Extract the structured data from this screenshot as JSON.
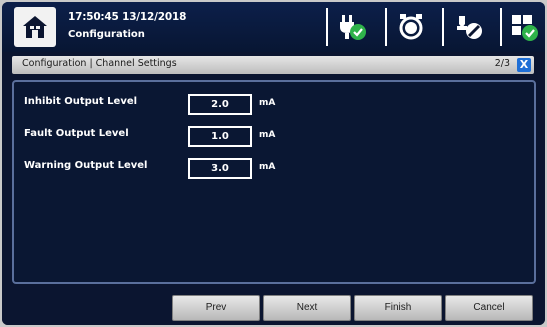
{
  "header": {
    "datetime": "17:50:45 13/12/2018",
    "subtitle": "Configuration",
    "icons": [
      "home-icon",
      "power-plug-ok-icon",
      "alarm-clock-icon",
      "calibration-off-icon",
      "grid-ok-icon"
    ]
  },
  "titlebar": {
    "title": "Configuration | Channel Settings",
    "page": "2/3",
    "close_label": "X"
  },
  "settings": [
    {
      "label": "Inhibit Output Level",
      "value": "2.0",
      "unit": "mA"
    },
    {
      "label": "Fault Output Level",
      "value": "1.0",
      "unit": "mA"
    },
    {
      "label": "Warning Output Level",
      "value": "3.0",
      "unit": "mA"
    }
  ],
  "footer": {
    "prev": "Prev",
    "next": "Next",
    "finish": "Finish",
    "cancel": "Cancel"
  },
  "colors": {
    "background": "#0b1530",
    "accent": "#1f6fd6",
    "ok_green": "#2fb34a"
  }
}
